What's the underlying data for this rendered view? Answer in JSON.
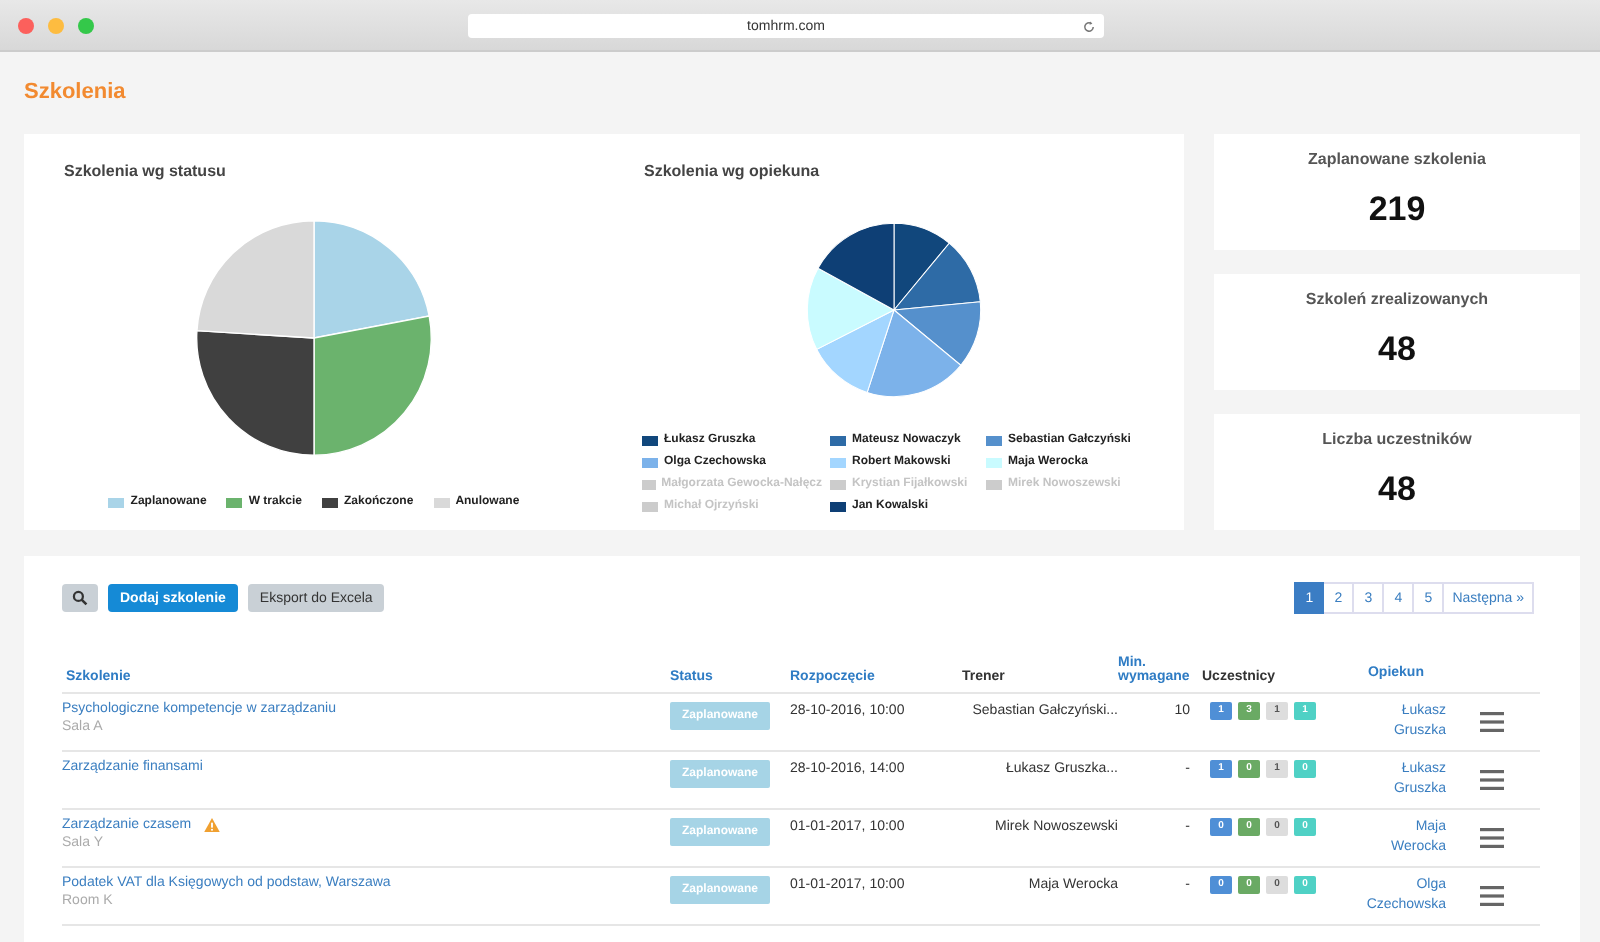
{
  "browser": {
    "url": "tomhrm.com"
  },
  "page_title": "Szkolenia",
  "charts": [
    {
      "title": "Szkolenia wg statusu",
      "legend": [
        {
          "label": "Zaplanowane",
          "color": "#a9d4e8",
          "hidden": false
        },
        {
          "label": "W trakcie",
          "color": "#6bb36d",
          "hidden": false
        },
        {
          "label": "Zakończone",
          "color": "#404040",
          "hidden": false
        },
        {
          "label": "Anulowane",
          "color": "#d9d9d9",
          "hidden": false
        }
      ]
    },
    {
      "title": "Szkolenia wg opiekuna",
      "legend": [
        {
          "label": "Łukasz Gruszka",
          "color": "#11477c",
          "hidden": false
        },
        {
          "label": "Mateusz Nowaczyk",
          "color": "#2e6ba6",
          "hidden": false
        },
        {
          "label": "Sebastian Gałczyński",
          "color": "#5590cc",
          "hidden": false
        },
        {
          "label": "Olga Czechowska",
          "color": "#7cb2ea",
          "hidden": false
        },
        {
          "label": "Robert Makowski",
          "color": "#a3d6ff",
          "hidden": false
        },
        {
          "label": "Maja Werocka",
          "color": "#c9fbff",
          "hidden": false
        },
        {
          "label": "Małgorzata Gewocka-Nałęcz",
          "hidden": true
        },
        {
          "label": "Krystian Fijałkowski",
          "hidden": true
        },
        {
          "label": "Mirek Nowoszewski",
          "hidden": true
        },
        {
          "label": "Michał Ojrzyński",
          "hidden": true
        },
        {
          "label": "Jan Kowalski",
          "color": "#0e3f75",
          "hidden": false
        }
      ]
    }
  ],
  "stats": [
    {
      "label": "Zaplanowane szkolenia",
      "value": "219"
    },
    {
      "label": "Szkoleń zrealizowanych",
      "value": "48"
    },
    {
      "label": "Liczba uczestników",
      "value": "48"
    }
  ],
  "toolbar": {
    "add_button": "Dodaj szkolenie",
    "export_button": "Eksport do Excela"
  },
  "pagination": {
    "pages": [
      {
        "label": "1",
        "selected": true
      },
      {
        "label": "2",
        "selected": false
      },
      {
        "label": "3",
        "selected": false
      },
      {
        "label": "4",
        "selected": false
      },
      {
        "label": "5",
        "selected": false
      }
    ],
    "next": "Następna »"
  },
  "table": {
    "columns": [
      {
        "label": "Szkolenie",
        "sortable": true
      },
      {
        "label": "Status",
        "sortable": true
      },
      {
        "label": "Rozpoczęcie",
        "sortable": true
      },
      {
        "label": "Trener",
        "sortable": false
      },
      {
        "label": "Min. wymagane",
        "sortable": true
      },
      {
        "label": "Uczestnicy",
        "sortable": false
      },
      {
        "label": "Opiekun",
        "sortable": true
      }
    ],
    "rows": [
      {
        "title": "Psychologiczne kompetencje w zarządzaniu",
        "room": "Sala A",
        "warning": false,
        "status": "Zaplanowane",
        "start": "28-10-2016, 10:00",
        "trainer": "Sebastian Gałczyński...",
        "min": "10",
        "participants": [
          {
            "count": "1",
            "color": "#4f8fd6"
          },
          {
            "count": "3",
            "color": "#6aaa64"
          },
          {
            "count": "1",
            "color": "#dddddd"
          },
          {
            "count": "1",
            "color": "#4fd1c5"
          }
        ],
        "guardian": "Łukasz Gruszka"
      },
      {
        "title": "Zarządzanie finansami",
        "warning": false,
        "status": "Zaplanowane",
        "start": "28-10-2016, 14:00",
        "trainer": "Łukasz Gruszka...",
        "min": "-",
        "participants": [
          {
            "count": "1",
            "color": "#4f8fd6"
          },
          {
            "count": "0",
            "color": "#6aaa64"
          },
          {
            "count": "1",
            "color": "#dddddd"
          },
          {
            "count": "0",
            "color": "#4fd1c5"
          }
        ],
        "guardian": "Łukasz Gruszka"
      },
      {
        "title": "Zarządzanie czasem",
        "room": "Sala Y",
        "warning": true,
        "status": "Zaplanowane",
        "start": "01-01-2017, 10:00",
        "trainer": "Mirek Nowoszewski",
        "min": "-",
        "participants": [
          {
            "count": "0",
            "color": "#4f8fd6"
          },
          {
            "count": "0",
            "color": "#6aaa64"
          },
          {
            "count": "0",
            "color": "#dddddd"
          },
          {
            "count": "0",
            "color": "#4fd1c5"
          }
        ],
        "guardian": "Maja Werocka"
      },
      {
        "title": "Podatek VAT dla Księgowych od podstaw, Warszawa",
        "room": "Room K",
        "warning": false,
        "status": "Zaplanowane",
        "start": "01-01-2017, 10:00",
        "trainer": "Maja Werocka",
        "min": "-",
        "participants": [
          {
            "count": "0",
            "color": "#4f8fd6"
          },
          {
            "count": "0",
            "color": "#6aaa64"
          },
          {
            "count": "0",
            "color": "#dddddd"
          },
          {
            "count": "0",
            "color": "#4fd1c5"
          }
        ],
        "guardian": "Olga Czechowska"
      }
    ]
  }
}
